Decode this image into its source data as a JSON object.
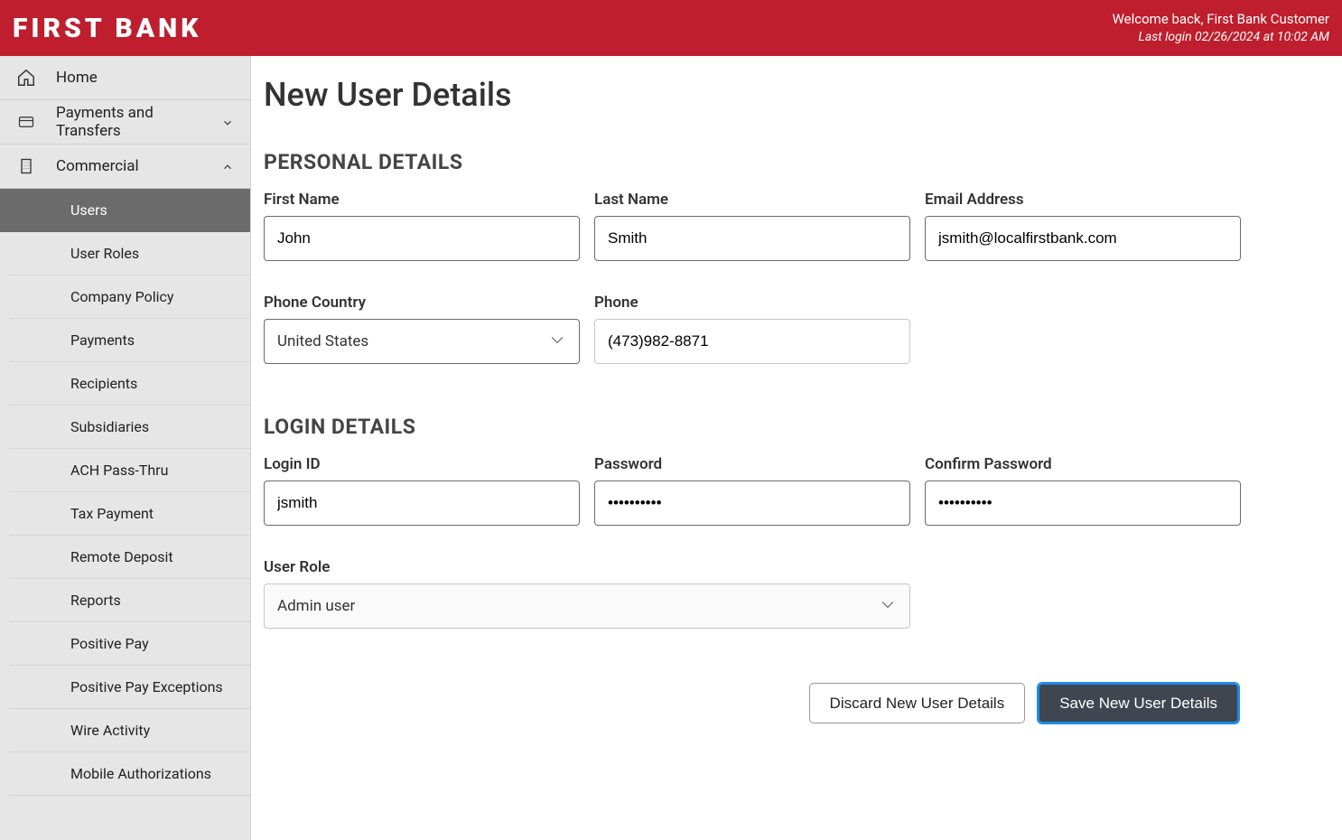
{
  "brand": "FIRST BANK",
  "welcome": "Welcome back, First Bank Customer",
  "last_login": "Last login 02/26/2024 at 10:02 AM",
  "nav": {
    "home": "Home",
    "payments_transfers": "Payments and Transfers",
    "commercial": "Commercial",
    "items": [
      {
        "label": "Users",
        "active": true
      },
      {
        "label": "User Roles",
        "active": false
      },
      {
        "label": "Company Policy",
        "active": false
      },
      {
        "label": "Payments",
        "active": false
      },
      {
        "label": "Recipients",
        "active": false
      },
      {
        "label": "Subsidiaries",
        "active": false
      },
      {
        "label": "ACH Pass-Thru",
        "active": false
      },
      {
        "label": "Tax Payment",
        "active": false
      },
      {
        "label": "Remote Deposit",
        "active": false
      },
      {
        "label": "Reports",
        "active": false
      },
      {
        "label": "Positive Pay",
        "active": false
      },
      {
        "label": "Positive Pay Exceptions",
        "active": false
      },
      {
        "label": "Wire Activity",
        "active": false
      },
      {
        "label": "Mobile Authorizations",
        "active": false
      }
    ]
  },
  "page_title": "New User Details",
  "sections": {
    "personal": "PERSONAL DETAILS",
    "login": "LOGIN DETAILS"
  },
  "fields": {
    "first_name": {
      "label": "First Name",
      "value": "John"
    },
    "last_name": {
      "label": "Last Name",
      "value": "Smith"
    },
    "email": {
      "label": "Email Address",
      "value": "jsmith@localfirstbank.com"
    },
    "phone_country": {
      "label": "Phone Country",
      "value": "United States"
    },
    "phone": {
      "label": "Phone",
      "value": "(473)982-8871"
    },
    "login_id": {
      "label": "Login ID",
      "value": "jsmith"
    },
    "password": {
      "label": "Password",
      "value": "••••••••••"
    },
    "confirm_password": {
      "label": "Confirm Password",
      "value": "••••••••••"
    },
    "user_role": {
      "label": "User Role",
      "value": "Admin user"
    }
  },
  "buttons": {
    "discard": "Discard New User Details",
    "save": "Save New User Details"
  }
}
